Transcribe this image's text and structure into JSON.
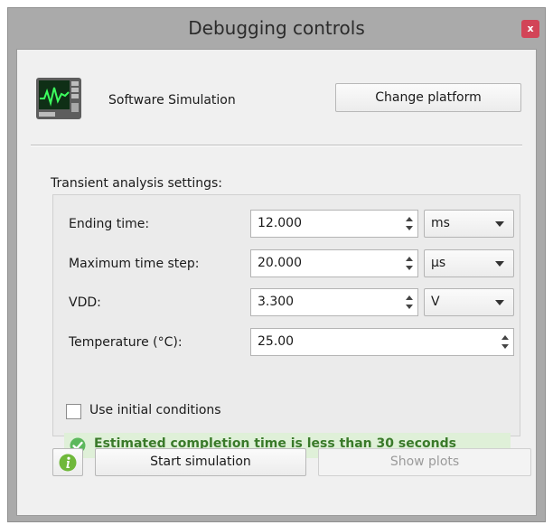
{
  "window": {
    "title": "Debugging controls",
    "close_icon": "x"
  },
  "platform": {
    "icon": "oscilloscope-monitor-icon",
    "label": "Software Simulation",
    "change_button": "Change platform"
  },
  "transient": {
    "group_title": "Transient analysis settings:",
    "ending_time": {
      "label": "Ending time:",
      "value": "12.000",
      "unit": "ms"
    },
    "max_time_step": {
      "label": "Maximum time step:",
      "value": "20.000",
      "unit": "µs"
    },
    "vdd": {
      "label": "VDD:",
      "value": "3.300",
      "unit": "V"
    },
    "temperature": {
      "label": "Temperature (°C):",
      "value": "25.00"
    },
    "use_initial_conditions": {
      "label": "Use initial conditions",
      "checked": false
    },
    "estimate": {
      "icon": "check-circle-icon",
      "text": "Estimated completion time is less than 30 seconds",
      "color": "#3a7a2a"
    }
  },
  "actions": {
    "info_icon": "info-icon",
    "start": "Start simulation",
    "show_plots": "Show plots"
  },
  "colors": {
    "titlebar": "#aaaaaa",
    "close": "#d24457",
    "success_bg": "#dff0d8",
    "success_icon": "#5cb85c"
  }
}
